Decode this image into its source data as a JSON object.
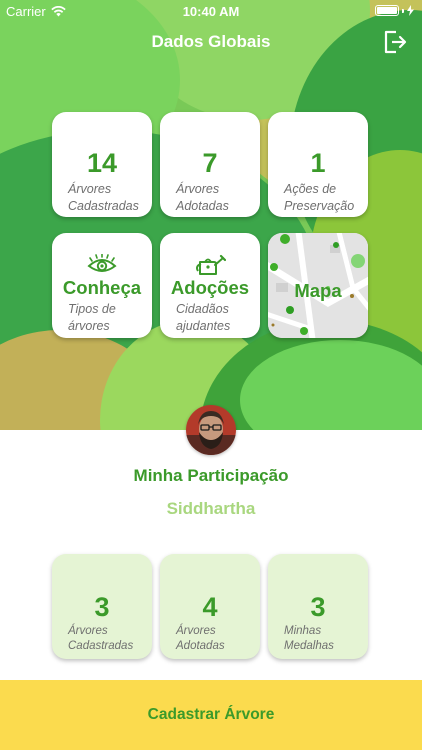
{
  "status_bar": {
    "carrier": "Carrier",
    "time": "10:40 AM"
  },
  "nav": {
    "title": "Dados Globais",
    "logout_icon": "logout-icon"
  },
  "global_stats": [
    {
      "value": "14",
      "label": "Árvores\nCadastradas"
    },
    {
      "value": "7",
      "label": "Árvores\nAdotadas"
    },
    {
      "value": "1",
      "label": "Ações de\nPreservação"
    }
  ],
  "features": {
    "conheca": {
      "title": "Conheça",
      "subtitle": "Tipos de\nárvores",
      "icon": "eye-icon"
    },
    "adocoes": {
      "title": "Adoções",
      "subtitle": "Cidadãos\najudantes",
      "icon": "watering-can-icon"
    },
    "mapa": {
      "title": "Mapa"
    }
  },
  "participation": {
    "title": "Minha Participação",
    "username": "Siddhartha"
  },
  "my_stats": [
    {
      "value": "3",
      "label": "Árvores\nCadastradas"
    },
    {
      "value": "4",
      "label": "Árvores\nAdotadas"
    },
    {
      "value": "3",
      "label": "Minhas\nMedalhas"
    }
  ],
  "cta": {
    "label": "Cadastrar Árvore"
  },
  "colors": {
    "primary_green": "#3b9a2a",
    "light_green": "#a9d77f",
    "card_tint": "#e5f4d4",
    "cta_yellow": "#fbdb4e"
  }
}
